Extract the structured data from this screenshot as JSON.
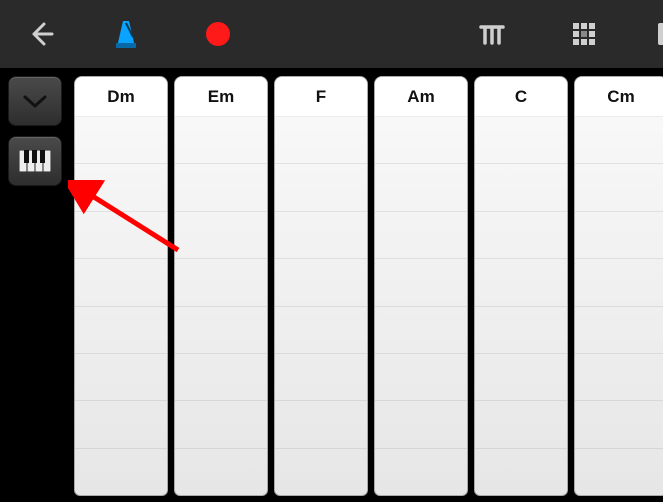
{
  "toolbar": {
    "back": "Back",
    "metronome": "Metronome",
    "record": "Record",
    "arpeggiator": "Arpeggiator",
    "grid": "Grid View"
  },
  "side": {
    "collapse": "Collapse",
    "keyboard": "Keyboard"
  },
  "chords": [
    "Dm",
    "Em",
    "F",
    "Am",
    "C",
    "Cm"
  ],
  "segment_count": 8,
  "colors": {
    "accent_blue": "#0aa3ff",
    "record_red": "#ff1a1a",
    "toolbar_bg": "#2a2a2a",
    "arrow": "#ff0000"
  }
}
